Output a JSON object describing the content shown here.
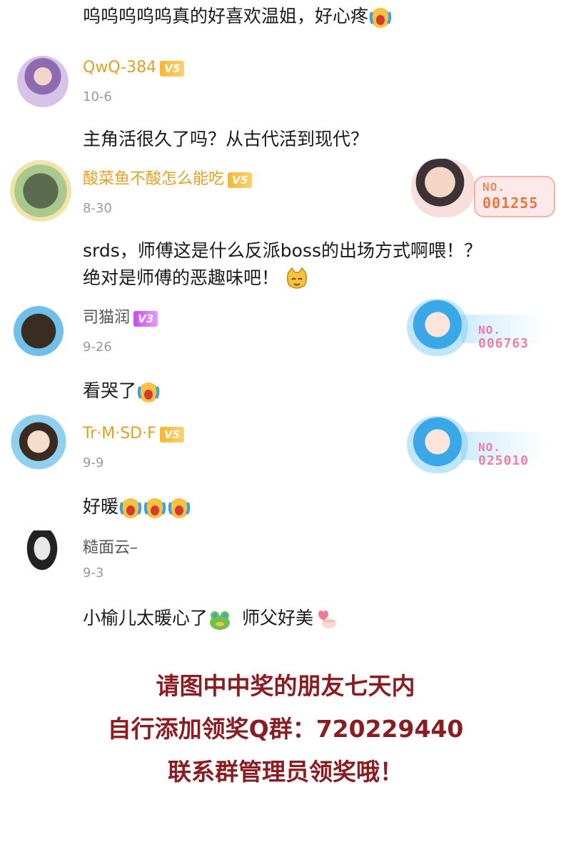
{
  "comments": [
    {
      "text": "呜呜呜呜呜真的好喜欢温姐，好心疼"
    },
    {
      "user": "QwQ-384",
      "level": "V5",
      "date": "10-6",
      "text": "主角活很久了吗？从古代活到现代？"
    },
    {
      "user": "酸菜鱼不酸怎么能吃",
      "level": "V5",
      "date": "8-30",
      "card_no_label": "NO.",
      "card_no": "001255",
      "text_line1": "srds，师傅这是什么反派boss的出场方式啊喂！？",
      "text_line2": "绝对是师傅的恶趣味吧！"
    },
    {
      "user": "司猫润",
      "level": "V3",
      "date": "9-26",
      "card_no_label": "NO.",
      "card_no": "006763",
      "text": "看哭了"
    },
    {
      "user": "Tr·M·SD·F",
      "level": "V5",
      "date": "9-9",
      "card_no_label": "NO.",
      "card_no": "025010",
      "text": "好暖"
    },
    {
      "user": "糙面云–",
      "date": "9-3",
      "text_part1": "小榆儿太暖心了",
      "text_part2": "师父好美"
    }
  ],
  "notice": {
    "line1": "请图中中奖的朋友七天内",
    "line2": "自行添加领奖Q群：720229440",
    "line3": "联系群管理员领奖哦！"
  },
  "colors": {
    "gold": "#e0a020",
    "notice": "#8a1c22",
    "date": "#999999"
  }
}
